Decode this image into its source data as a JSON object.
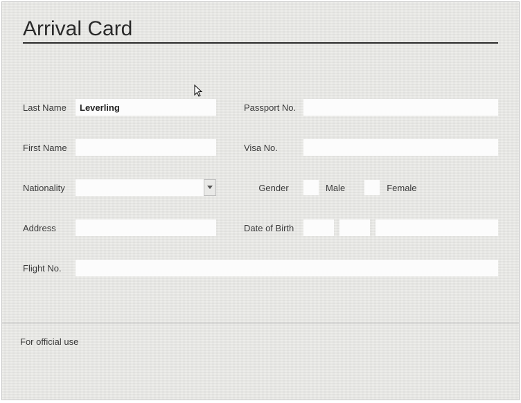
{
  "title": "Arrival Card",
  "labels": {
    "lastName": "Last Name",
    "firstName": "First Name",
    "nationality": "Nationality",
    "address": "Address",
    "flightNo": "Flight No.",
    "passportNo": "Passport No.",
    "visaNo": "Visa No.",
    "gender": "Gender",
    "male": "Male",
    "female": "Female",
    "dob": "Date of Birth"
  },
  "values": {
    "lastName": "Leverling",
    "firstName": "",
    "nationality": "",
    "address": "",
    "flightNo": "",
    "passportNo": "",
    "visaNo": "",
    "dobDay": "",
    "dobMonth": "",
    "dobYear": ""
  },
  "officialUse": "For official use"
}
